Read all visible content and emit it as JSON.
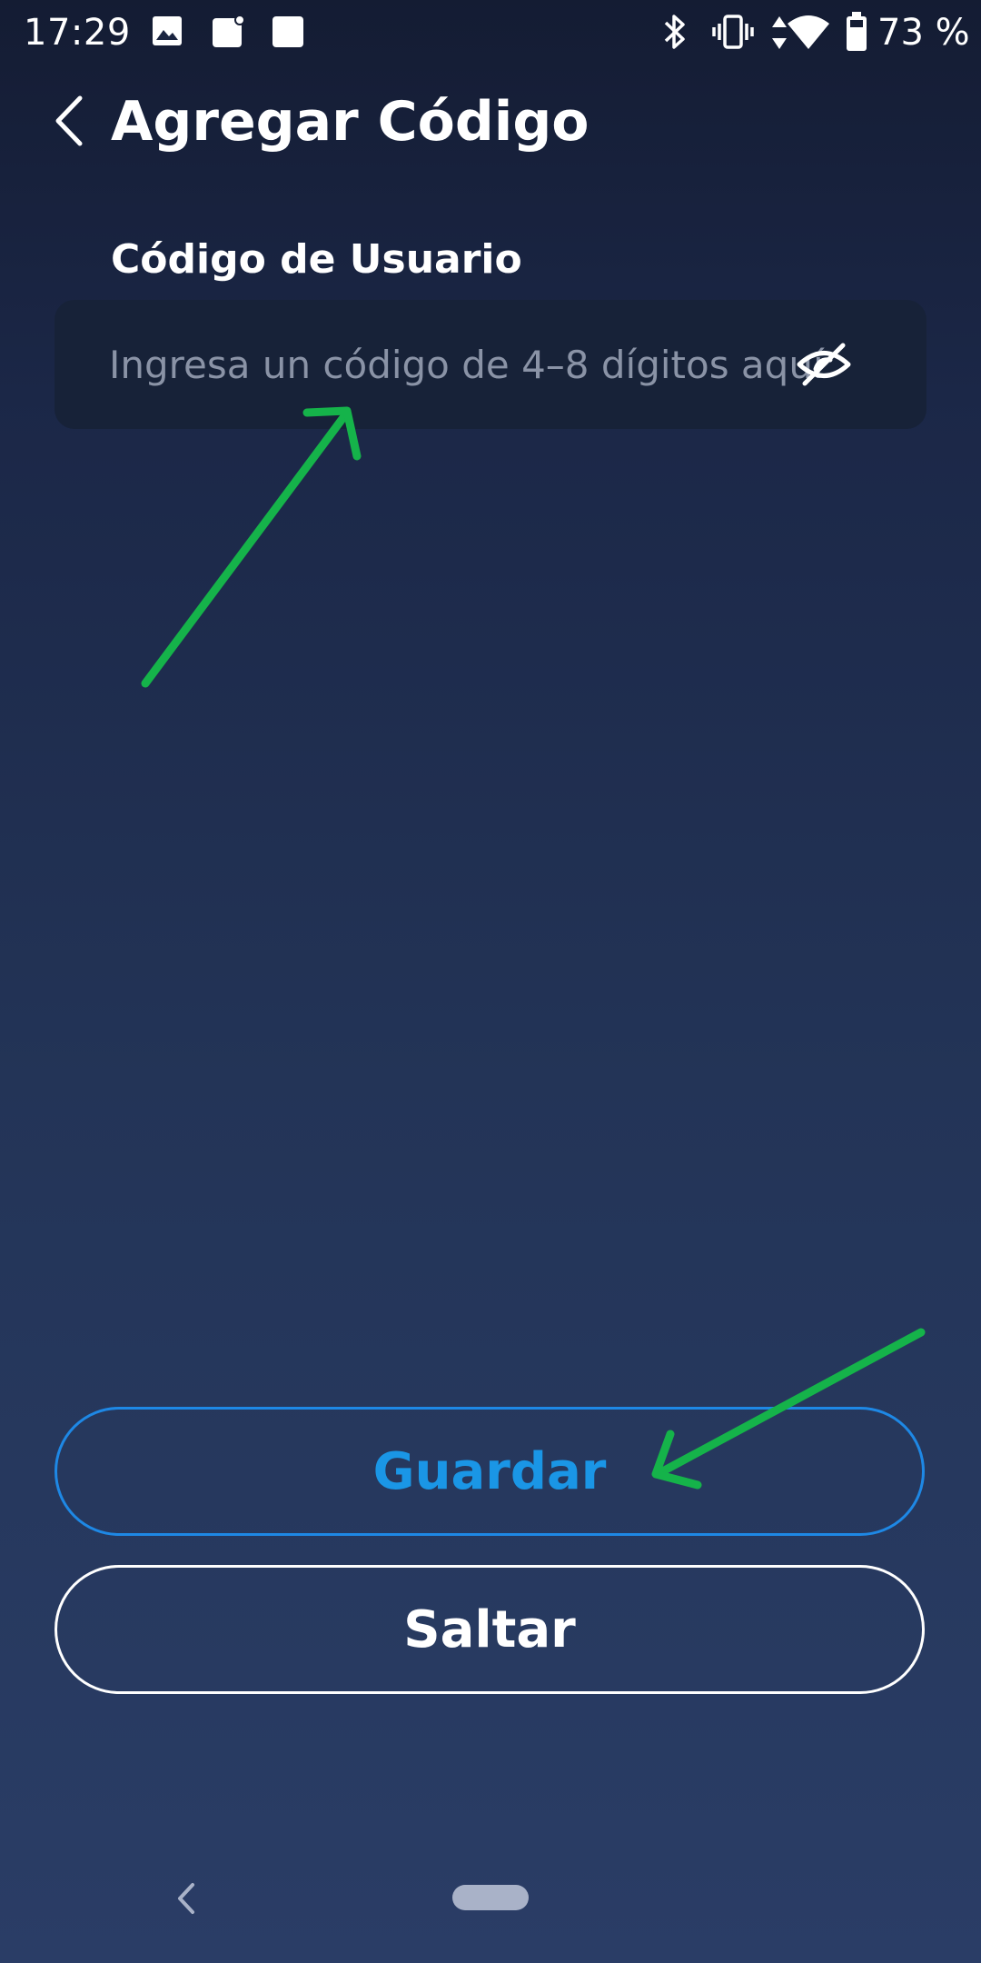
{
  "status_bar": {
    "time": "17:29",
    "battery_text": "73 %",
    "icons": [
      "image-icon",
      "notification-icon",
      "square-icon",
      "bluetooth-icon",
      "vibrate-icon",
      "data-arrows-icon",
      "wifi-icon",
      "battery-icon"
    ]
  },
  "header": {
    "title": "Agregar Código",
    "back_icon": "chevron-left-icon"
  },
  "form": {
    "code_label": "Código de Usuario",
    "code_placeholder": "Ingresa un código de 4–8 dígitos aquí",
    "code_value": "",
    "visibility_icon": "eye-off-icon"
  },
  "actions": {
    "save_label": "Guardar",
    "skip_label": "Saltar"
  },
  "nav_bar": {
    "back_icon": "nav-back-icon",
    "home_icon": "nav-home-pill"
  },
  "colors": {
    "background_top": "#141c33",
    "background_bottom": "#2a3d66",
    "field_background": "#172238",
    "primary_accent": "#1a96e6",
    "annotation_arrow": "#15b34a"
  }
}
